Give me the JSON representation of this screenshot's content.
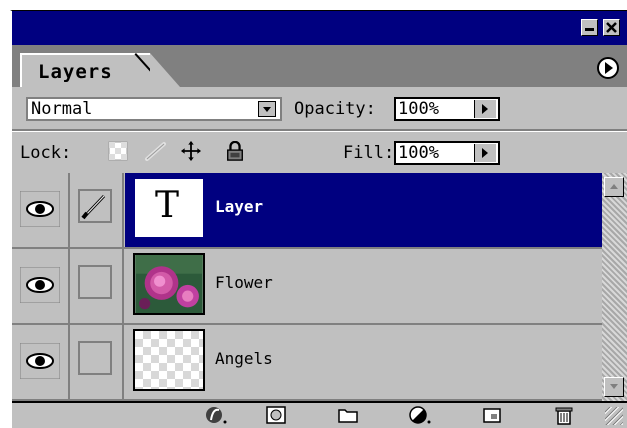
{
  "panel": {
    "tab_label": "Layers",
    "blend_mode": "Normal",
    "opacity_label": "Opacity:",
    "opacity_value": "100%",
    "lock_label": "Lock:",
    "fill_label": "Fill:",
    "fill_value": "100%"
  },
  "layers": [
    {
      "name": "Layer",
      "thumb_type": "text-T",
      "visible": true,
      "selected": true,
      "link_brush": true
    },
    {
      "name": "Flower",
      "thumb_type": "flower-photo",
      "visible": true,
      "selected": false,
      "link_brush": false
    },
    {
      "name": "Angels",
      "thumb_type": "transparent",
      "visible": true,
      "selected": false,
      "link_brush": false
    }
  ],
  "thumb_glyph": "T",
  "bottom_toolbar": {
    "icons": [
      "layer-style-icon",
      "mask-icon",
      "new-set-icon",
      "adjustment-layer-icon",
      "new-layer-icon",
      "trash-icon"
    ]
  },
  "colors": {
    "title_bar": "#000080",
    "selected_row": "#000080",
    "panel_bg": "#c0c0c0"
  }
}
